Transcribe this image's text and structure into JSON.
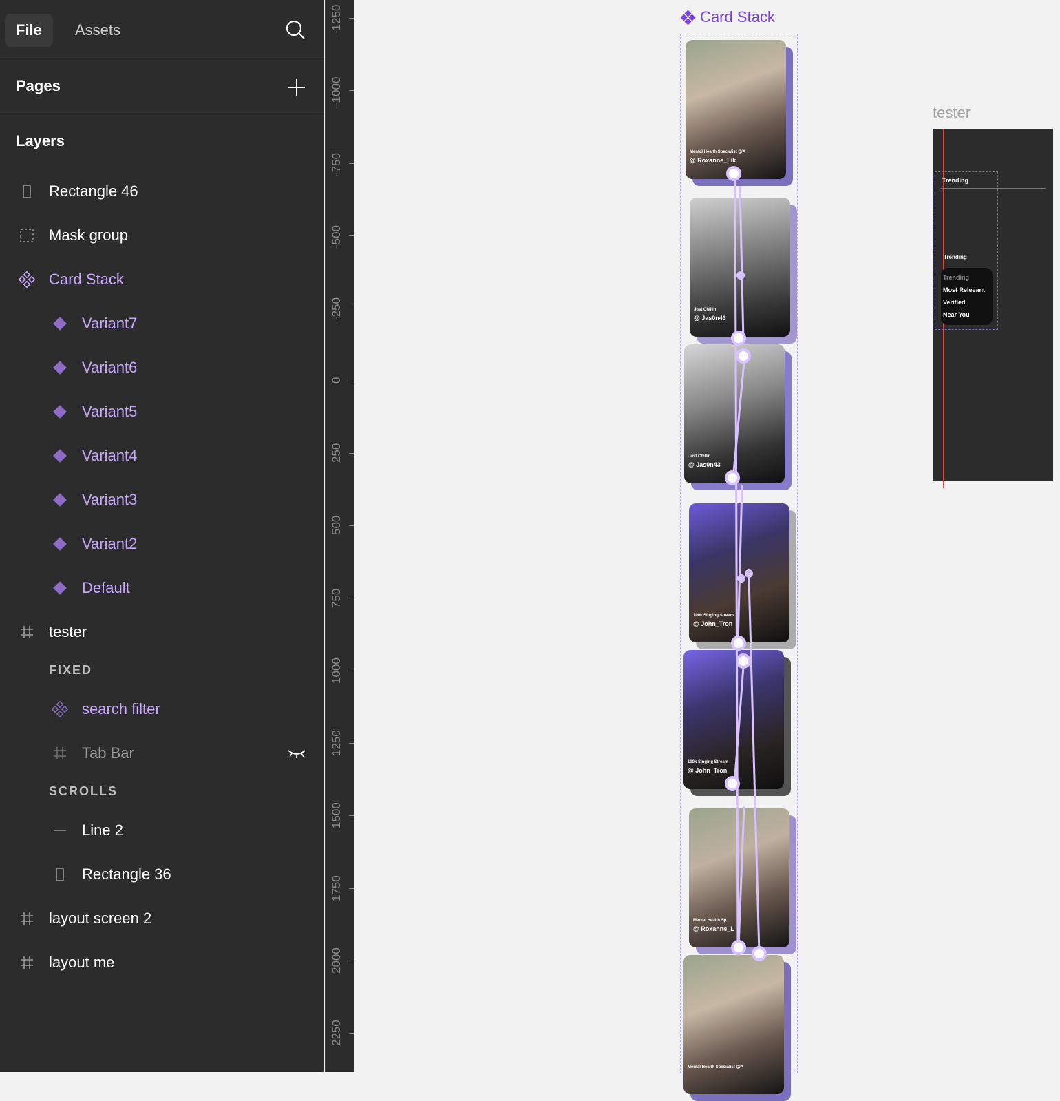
{
  "sidebar": {
    "tabs": {
      "file": "File",
      "assets": "Assets"
    },
    "pages_title": "Pages",
    "layers_title": "Layers",
    "layers": [
      {
        "label": "Rectangle 46",
        "icon": "rectangle-icon",
        "color": "white"
      },
      {
        "label": "Mask group",
        "icon": "mask-group-icon",
        "color": "white"
      },
      {
        "label": "Card Stack",
        "icon": "component-set-icon",
        "color": "purple"
      },
      {
        "label": "Variant7",
        "icon": "variant-icon",
        "color": "purple"
      },
      {
        "label": "Variant6",
        "icon": "variant-icon",
        "color": "purple"
      },
      {
        "label": "Variant5",
        "icon": "variant-icon",
        "color": "purple"
      },
      {
        "label": "Variant4",
        "icon": "variant-icon",
        "color": "purple"
      },
      {
        "label": "Variant3",
        "icon": "variant-icon",
        "color": "purple"
      },
      {
        "label": "Variant2",
        "icon": "variant-icon",
        "color": "purple"
      },
      {
        "label": "Default",
        "icon": "variant-icon",
        "color": "purple"
      },
      {
        "label": "tester",
        "icon": "frame-icon",
        "color": "white"
      },
      {
        "label": "search filter",
        "icon": "component-instance-icon",
        "color": "purple"
      },
      {
        "label": "Tab Bar",
        "icon": "frame-icon",
        "color": "dim"
      },
      {
        "label": "Line 2",
        "icon": "line-icon",
        "color": "white"
      },
      {
        "label": "Rectangle 36",
        "icon": "rectangle-icon",
        "color": "white"
      },
      {
        "label": "layout screen 2",
        "icon": "frame-icon",
        "color": "white"
      },
      {
        "label": "layout me",
        "icon": "frame-icon",
        "color": "white"
      }
    ],
    "sections": {
      "fixed": "FIXED",
      "scrolls": "SCROLLS"
    }
  },
  "ruler": {
    "labels": [
      "-1250",
      "-1000",
      "-750",
      "-500",
      "-250",
      "0",
      "250",
      "500",
      "750",
      "1000",
      "1250",
      "1500",
      "1750",
      "2000",
      "2250"
    ]
  },
  "canvas": {
    "card_stack_label": "Card Stack",
    "tester_label": "tester",
    "cards": [
      {
        "caption": "Mental Health Specialist Q/A",
        "handle": "@ Roxanne_Lik"
      },
      {
        "caption": "Just Chillin",
        "handle": "@ Jas0n43"
      },
      {
        "caption": "Just Chillin",
        "handle": "@ Jas0n43"
      },
      {
        "caption": "100k Singing Stream",
        "handle": "@ John_Tron"
      },
      {
        "caption": "100k Singing Stream",
        "handle": "@ John_Tron"
      },
      {
        "caption": "Mental Health Sp",
        "handle": "@ Roxanne_L"
      },
      {
        "caption": "Mental Health Specialist Q/A",
        "handle": ""
      }
    ],
    "tester": {
      "header": "Trending",
      "chip": "Trending",
      "options": [
        "Trending",
        "Most Relevant",
        "Verified",
        "Near You"
      ]
    }
  },
  "colors": {
    "accent": "#c9a6ff",
    "component": "#7b3fe4",
    "panel": "#2c2c2c",
    "canvas": "#f2f2f2"
  }
}
